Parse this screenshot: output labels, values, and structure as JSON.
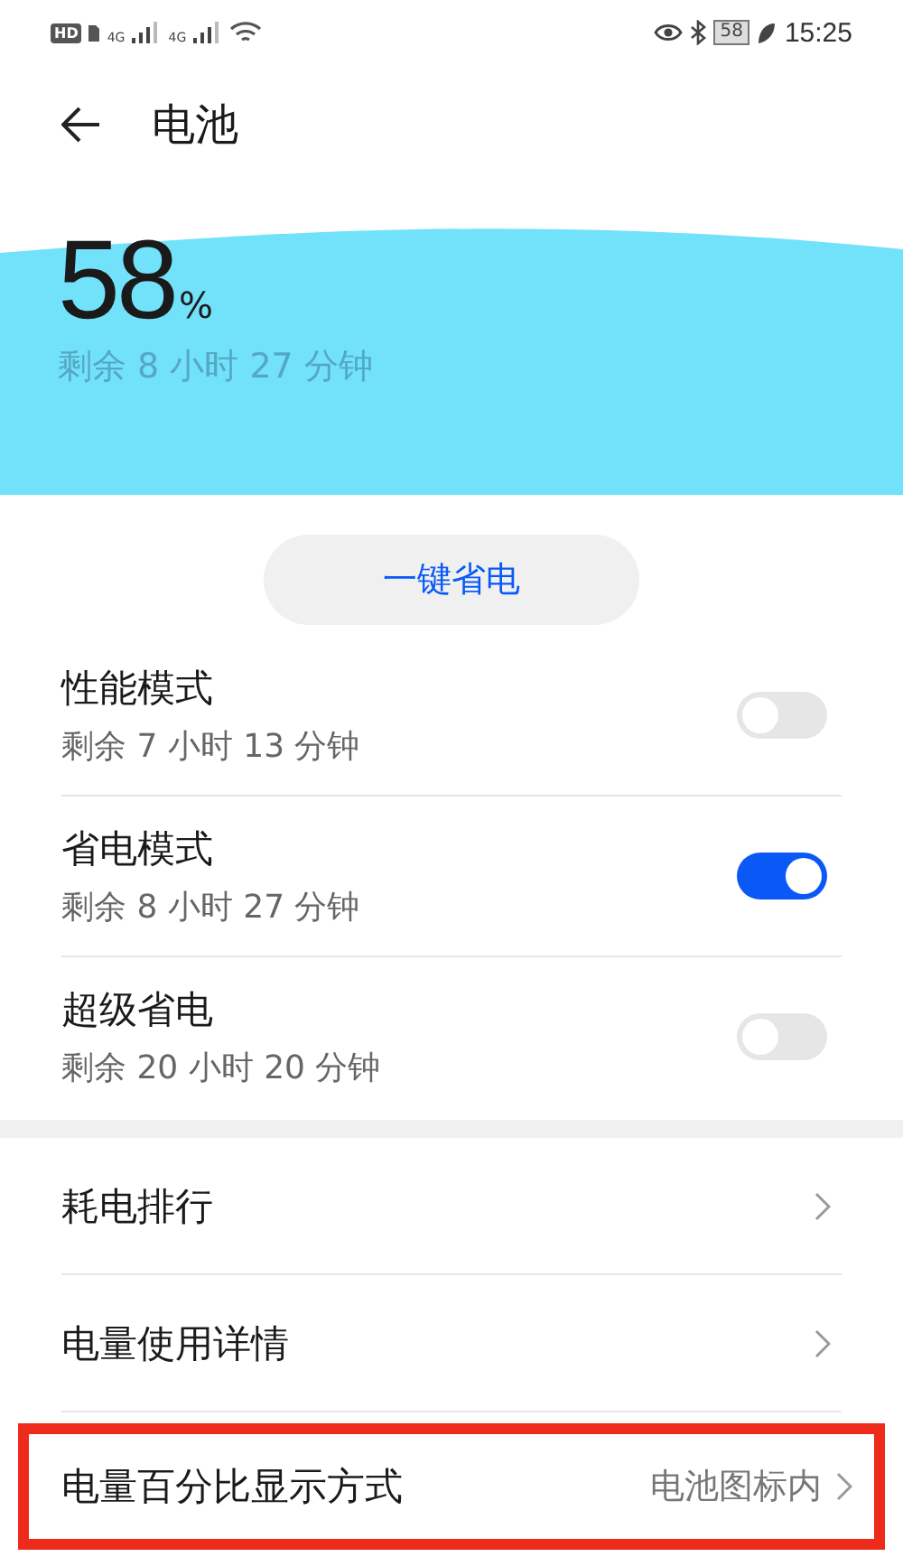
{
  "status_bar": {
    "hd_badge": "HD",
    "signal_labels": [
      "4G",
      "4G"
    ],
    "battery": "58",
    "time": "15:25"
  },
  "header": {
    "title": "电池"
  },
  "summary": {
    "percent": "58",
    "unit": "%",
    "remaining": "剩余 8 小时 27 分钟"
  },
  "one_tap_button": "一键省电",
  "modes": [
    {
      "title": "性能模式",
      "subtitle": "剩余 7 小时 13 分钟",
      "on": false
    },
    {
      "title": "省电模式",
      "subtitle": "剩余 8 小时 27 分钟",
      "on": true
    },
    {
      "title": "超级省电",
      "subtitle": "剩余 20 小时 20 分钟",
      "on": false
    }
  ],
  "links": [
    {
      "label": "耗电排行",
      "highlighted": false
    },
    {
      "label": "电量使用详情",
      "highlighted": false
    },
    {
      "label": "电量百分比显示方式",
      "value": "电池图标内",
      "highlighted": true
    }
  ]
}
